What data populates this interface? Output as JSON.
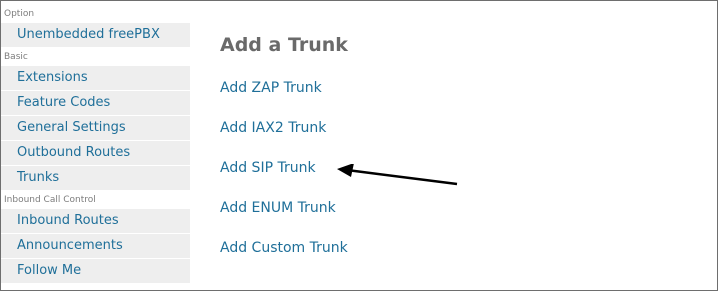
{
  "sidebar": {
    "sections": [
      {
        "header": "Option",
        "items": [
          {
            "label": "Unembedded freePBX"
          }
        ]
      },
      {
        "header": "Basic",
        "items": [
          {
            "label": "Extensions"
          },
          {
            "label": "Feature Codes"
          },
          {
            "label": "General Settings"
          },
          {
            "label": "Outbound Routes"
          },
          {
            "label": "Trunks"
          }
        ]
      },
      {
        "header": "Inbound Call Control",
        "items": [
          {
            "label": "Inbound Routes"
          },
          {
            "label": "Announcements"
          },
          {
            "label": "Follow Me"
          }
        ]
      }
    ]
  },
  "main": {
    "title": "Add a Trunk",
    "links": [
      {
        "label": "Add ZAP Trunk"
      },
      {
        "label": "Add IAX2 Trunk"
      },
      {
        "label": "Add SIP Trunk"
      },
      {
        "label": "Add ENUM Trunk"
      },
      {
        "label": "Add Custom Trunk"
      }
    ]
  },
  "annotation": {
    "icon": "arrow-left-icon",
    "color": "#000000"
  },
  "colors": {
    "link": "#1f6f99",
    "nav_bg": "#eeeeee",
    "title": "#6a6a6a",
    "section_header": "#7d7d7d"
  }
}
